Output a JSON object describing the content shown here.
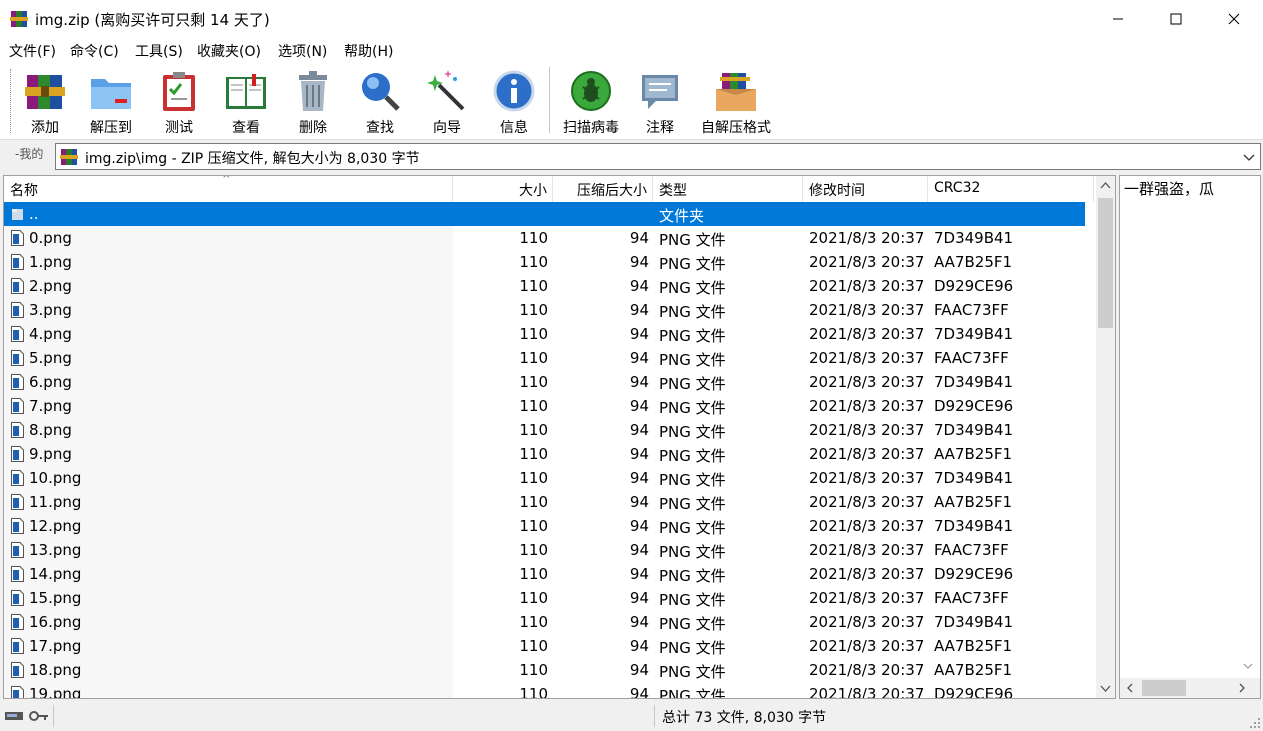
{
  "window": {
    "title": "img.zip (离购买许可只剩 14 天了)"
  },
  "menu": [
    "文件(F)",
    "命令(C)",
    "工具(S)",
    "收藏夹(O)",
    "选项(N)",
    "帮助(H)"
  ],
  "toolbar": {
    "buttons": [
      {
        "label": "添加",
        "icon": "add-archive-icon"
      },
      {
        "label": "解压到",
        "icon": "extract-folder-icon"
      },
      {
        "label": "测试",
        "icon": "test-clipboard-icon"
      },
      {
        "label": "查看",
        "icon": "view-book-icon"
      },
      {
        "label": "删除",
        "icon": "trash-icon"
      },
      {
        "label": "查找",
        "icon": "magnifier-icon"
      },
      {
        "label": "向导",
        "icon": "wizard-wand-icon"
      },
      {
        "label": "信息",
        "icon": "info-icon"
      },
      {
        "label": "扫描病毒",
        "icon": "virus-scan-icon"
      },
      {
        "label": "注释",
        "icon": "comment-icon"
      },
      {
        "label": "自解压格式",
        "icon": "sfx-box-icon"
      }
    ]
  },
  "address": {
    "label": "-我的",
    "path": "img.zip\\img - ZIP 压缩文件, 解包大小为 8,030 字节"
  },
  "columns": {
    "name": "名称",
    "size": "大小",
    "packed": "压缩后大小",
    "type": "类型",
    "mtime": "修改时间",
    "crc": "CRC32"
  },
  "parent_row": {
    "name": "..",
    "type": "文件夹"
  },
  "files": [
    {
      "name": "0.png",
      "size": "110",
      "packed": "94",
      "type": "PNG 文件",
      "mtime": "2021/8/3 20:37",
      "crc": "7D349B41"
    },
    {
      "name": "1.png",
      "size": "110",
      "packed": "94",
      "type": "PNG 文件",
      "mtime": "2021/8/3 20:37",
      "crc": "AA7B25F1"
    },
    {
      "name": "2.png",
      "size": "110",
      "packed": "94",
      "type": "PNG 文件",
      "mtime": "2021/8/3 20:37",
      "crc": "D929CE96"
    },
    {
      "name": "3.png",
      "size": "110",
      "packed": "94",
      "type": "PNG 文件",
      "mtime": "2021/8/3 20:37",
      "crc": "FAAC73FF"
    },
    {
      "name": "4.png",
      "size": "110",
      "packed": "94",
      "type": "PNG 文件",
      "mtime": "2021/8/3 20:37",
      "crc": "7D349B41"
    },
    {
      "name": "5.png",
      "size": "110",
      "packed": "94",
      "type": "PNG 文件",
      "mtime": "2021/8/3 20:37",
      "crc": "FAAC73FF"
    },
    {
      "name": "6.png",
      "size": "110",
      "packed": "94",
      "type": "PNG 文件",
      "mtime": "2021/8/3 20:37",
      "crc": "7D349B41"
    },
    {
      "name": "7.png",
      "size": "110",
      "packed": "94",
      "type": "PNG 文件",
      "mtime": "2021/8/3 20:37",
      "crc": "D929CE96"
    },
    {
      "name": "8.png",
      "size": "110",
      "packed": "94",
      "type": "PNG 文件",
      "mtime": "2021/8/3 20:37",
      "crc": "7D349B41"
    },
    {
      "name": "9.png",
      "size": "110",
      "packed": "94",
      "type": "PNG 文件",
      "mtime": "2021/8/3 20:37",
      "crc": "AA7B25F1"
    },
    {
      "name": "10.png",
      "size": "110",
      "packed": "94",
      "type": "PNG 文件",
      "mtime": "2021/8/3 20:37",
      "crc": "7D349B41"
    },
    {
      "name": "11.png",
      "size": "110",
      "packed": "94",
      "type": "PNG 文件",
      "mtime": "2021/8/3 20:37",
      "crc": "AA7B25F1"
    },
    {
      "name": "12.png",
      "size": "110",
      "packed": "94",
      "type": "PNG 文件",
      "mtime": "2021/8/3 20:37",
      "crc": "7D349B41"
    },
    {
      "name": "13.png",
      "size": "110",
      "packed": "94",
      "type": "PNG 文件",
      "mtime": "2021/8/3 20:37",
      "crc": "FAAC73FF"
    },
    {
      "name": "14.png",
      "size": "110",
      "packed": "94",
      "type": "PNG 文件",
      "mtime": "2021/8/3 20:37",
      "crc": "D929CE96"
    },
    {
      "name": "15.png",
      "size": "110",
      "packed": "94",
      "type": "PNG 文件",
      "mtime": "2021/8/3 20:37",
      "crc": "FAAC73FF"
    },
    {
      "name": "16.png",
      "size": "110",
      "packed": "94",
      "type": "PNG 文件",
      "mtime": "2021/8/3 20:37",
      "crc": "7D349B41"
    },
    {
      "name": "17.png",
      "size": "110",
      "packed": "94",
      "type": "PNG 文件",
      "mtime": "2021/8/3 20:37",
      "crc": "AA7B25F1"
    },
    {
      "name": "18.png",
      "size": "110",
      "packed": "94",
      "type": "PNG 文件",
      "mtime": "2021/8/3 20:37",
      "crc": "AA7B25F1"
    },
    {
      "name": "19.png",
      "size": "110",
      "packed": "94",
      "type": "PNG 文件",
      "mtime": "2021/8/3 20:37",
      "crc": "D929CE96"
    }
  ],
  "comment": {
    "text": "一群强盗，瓜"
  },
  "status": {
    "summary": "总计 73 文件, 8,030 字节"
  },
  "colors": {
    "selection": "#0078d7",
    "background": "#f0f0f0"
  }
}
